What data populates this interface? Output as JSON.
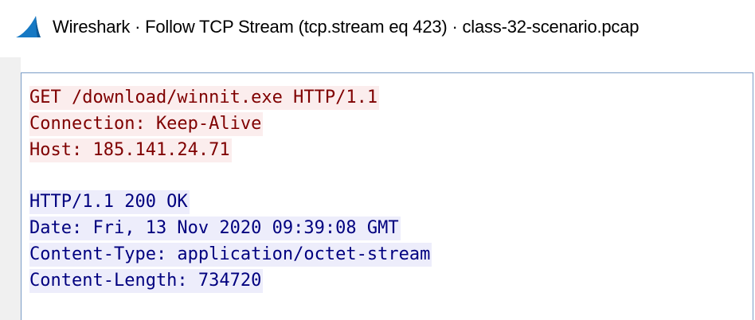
{
  "window": {
    "title": "Wireshark · Follow TCP Stream (tcp.stream eq 423) · class-32-scenario.pcap",
    "icon": "wireshark-fin-icon"
  },
  "colors": {
    "client_fg": "#7f0000",
    "client_bg": "#fbeded",
    "server_fg": "#00007f",
    "server_bg": "#ededfb",
    "pane_border": "#7a9cc6"
  },
  "stream": {
    "request_lines": [
      "GET /download/winnit.exe HTTP/1.1",
      "Connection: Keep-Alive",
      "Host: 185.141.24.71"
    ],
    "response_lines": [
      "HTTP/1.1 200 OK",
      "Date: Fri, 13 Nov 2020 09:39:08 GMT",
      "Content-Type: application/octet-stream",
      "Content-Length: 734720"
    ]
  }
}
